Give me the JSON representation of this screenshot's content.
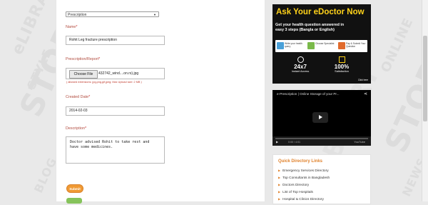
{
  "form": {
    "type_select": "Prescription",
    "name_label": "Name",
    "name_value": "Rohit Leg fracture prescription",
    "file_label": "Prescription/Report",
    "file_button": "Choose File",
    "file_name": "432742_wind....on.rs).jpg",
    "file_hint": "( allowed extensions: jpg,png,gif,jpeg; Max Upload size: 2 MB )",
    "date_label": "Created Date",
    "date_value": "2014-02-03",
    "desc_label": "Description",
    "desc_line1": "Doctor advised Rohit to take rest and",
    "desc_line2": "have some medicines.",
    "submit_label": "Submit",
    "required_mark": "*"
  },
  "ad": {
    "title": "Ask Your eDoctor Now",
    "subtitle_line1": "Get your health question answered in",
    "subtitle_line2": "easy 3 steps (Bangla or English)",
    "steps": [
      "Write your health query",
      "Choose Specialist",
      "Pay & Submit Your Question"
    ],
    "stat1_value": "24x7",
    "stat1_label": "Instant Access",
    "stat2_value": "100%",
    "stat2_label": "Satisfaction",
    "click_here": "Click here"
  },
  "video": {
    "title": "e-Prescription | Online Storage of your Pr...",
    "time": "0:00 / 4:01",
    "logo": "YouTube"
  },
  "quick_links": {
    "title": "Quick Directory Links",
    "items": [
      "Emergency Services Directory",
      "Top Consultants in Bangladesh",
      "Doctors Directory",
      "List of Top Hospitals",
      "Hospital & Clinics Directory"
    ]
  },
  "background": {
    "words": [
      "STORE",
      "eLIBRARY",
      "ONLINE",
      "BLOG",
      "STYLE",
      "NEWS"
    ]
  },
  "colors": {
    "label": "#b14b3e",
    "submit": "#f09a34",
    "ad_title": "#ffd21a",
    "link_accent": "#e0822c"
  }
}
